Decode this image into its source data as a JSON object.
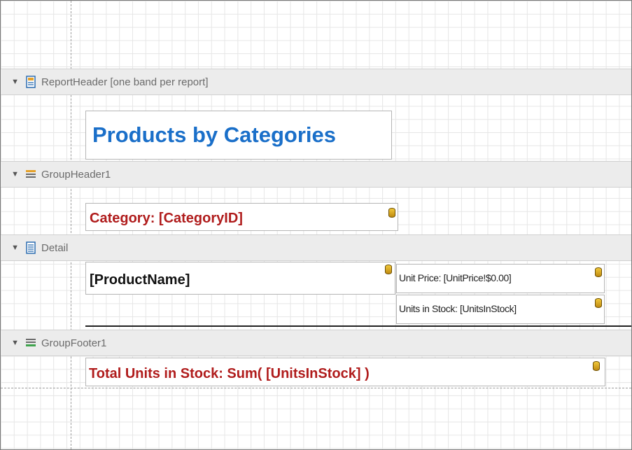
{
  "bands": {
    "report_header": {
      "label": "ReportHeader [one band per report]"
    },
    "group_header": {
      "label": "GroupHeader1"
    },
    "detail": {
      "label": "Detail"
    },
    "group_footer": {
      "label": "GroupFooter1"
    }
  },
  "controls": {
    "title": "Products by Categories",
    "category": "Category: [CategoryID]",
    "product_name": "[ProductName]",
    "unit_price": "Unit Price: [UnitPrice!$0.00]",
    "units_in_stock": "Units in Stock: [UnitsInStock]",
    "total_units": "Total Units in Stock: Sum( [UnitsInStock] )"
  },
  "colors": {
    "title": "#1a6fc9",
    "accent_red": "#b01c1c",
    "band_bg": "#ececec",
    "grid": "#e6e6e6"
  },
  "icons": {
    "collapse": "triangle-down-icon",
    "report_header": "report-header-icon",
    "group_header": "group-header-icon",
    "detail": "detail-icon",
    "group_footer": "group-footer-icon",
    "data_binding": "database-icon"
  }
}
